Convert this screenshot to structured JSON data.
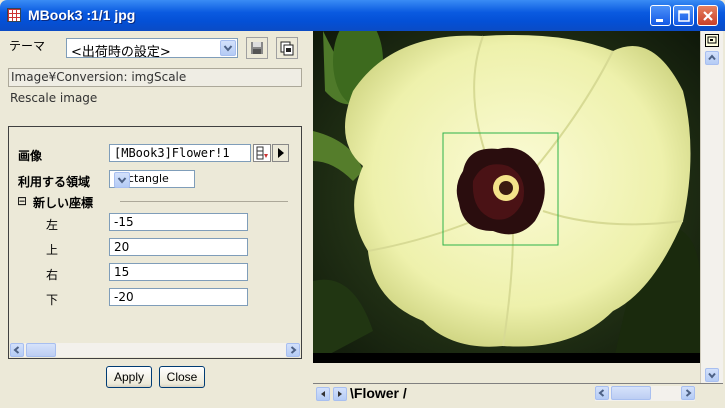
{
  "window": {
    "title": "MBook3 :1/1 jpg"
  },
  "theme": {
    "label": "テーマ",
    "value": "<出荷時の設定>"
  },
  "dialog": {
    "path": "Image¥Conversion: imgScale",
    "description": "Rescale image"
  },
  "params": {
    "image_label": "画像",
    "image_value": "[MBook3]Flower!1",
    "region_label": "利用する領域",
    "region_value": "Rectangle",
    "group_label": "新しい座標",
    "group_toggle": "⊟",
    "left_label": "左",
    "left_value": "-15",
    "top_label": "上",
    "top_value": "20",
    "right_label": "右",
    "right_value": "15",
    "bottom_label": "下",
    "bottom_value": "-20"
  },
  "buttons": {
    "apply": "Apply",
    "close": "Close"
  },
  "sheet": {
    "tab_label": "\\Flower /"
  },
  "colors": {
    "titlebar": "#0a5ae0",
    "selection_rect": "#2db34a",
    "flower": "#f2f4b5"
  }
}
